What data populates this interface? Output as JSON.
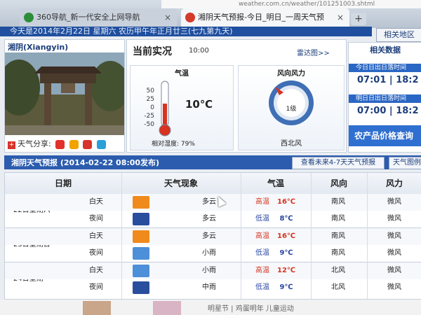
{
  "browser": {
    "tab1_title": "360导航_新一代安全上网导航",
    "tab2_title": "湘阴天气预报-今日_明日_一周天气预",
    "close_glyph": "×",
    "new_tab_glyph": "+",
    "url_fragment": "weather.com.cn/weather/101251003.shtml"
  },
  "header": {
    "date_line": "今天是2014年2月22日 星期六 农历甲午年正月廿三(七九第九天)",
    "region_button": "相关地区"
  },
  "city": {
    "name": "湘阴(Xiangyin)",
    "share_label": "天气分享:",
    "share_plus": "+",
    "social_colors": [
      "#e0312a",
      "#f2a300",
      "#d6332a",
      "#2a9fd8"
    ]
  },
  "current": {
    "title": "当前实况",
    "time": "10:00",
    "radar_link": "雷达图>>",
    "temp_label": "气温",
    "scale": [
      "50",
      "25",
      "0",
      "-25",
      "-50"
    ],
    "temp_value": "10℃",
    "humidity": "相对湿度: 79%",
    "wind_label": "风向风力",
    "wind_level": "1级",
    "wind_direction": "西北风"
  },
  "sidebar": {
    "title": "相关数据",
    "today_sun_label": "今日日出日落时间",
    "today_sunrise": "07:01",
    "today_sunset": "18:2",
    "tomorrow_sun_label": "明日日出日落时间",
    "tomorrow_sunrise": "07:00",
    "tomorrow_sunset": "18:2",
    "agri_link": "农产品价格查询"
  },
  "forecast": {
    "title": "湘阴天气预报 (2014-02-22 08:00发布)",
    "btn_week": "查看未来4-7天天气预报",
    "btn_map": "天气图例",
    "headers": [
      "日期",
      "天气现象",
      "气温",
      "风向",
      "风力"
    ],
    "days": [
      {
        "date": "22日星期六",
        "rows": [
          {
            "period": "白天",
            "icon": "cloudy-day-icon",
            "weather": "多云",
            "temp_label": "高温",
            "temp": "16℃",
            "wind_dir": "南风",
            "wind_force": "微风"
          },
          {
            "period": "夜间",
            "icon": "cloudy-night-icon",
            "weather": "多云",
            "temp_label": "低温",
            "temp": "8℃",
            "wind_dir": "南风",
            "wind_force": "微风"
          }
        ]
      },
      {
        "date": "23日星期日",
        "rows": [
          {
            "period": "白天",
            "icon": "cloudy-day-icon",
            "weather": "多云",
            "temp_label": "高温",
            "temp": "16℃",
            "wind_dir": "南风",
            "wind_force": "微风"
          },
          {
            "period": "夜间",
            "icon": "light-rain-icon",
            "weather": "小雨",
            "temp_label": "低温",
            "temp": "9℃",
            "wind_dir": "南风",
            "wind_force": "微风"
          }
        ]
      },
      {
        "date": "24日星期一",
        "rows": [
          {
            "period": "白天",
            "icon": "light-rain-icon",
            "weather": "小雨",
            "temp_label": "高温",
            "temp": "12℃",
            "wind_dir": "北风",
            "wind_force": "微风"
          },
          {
            "period": "夜间",
            "icon": "moderate-rain-icon",
            "weather": "中雨",
            "temp_label": "低温",
            "temp": "9℃",
            "wind_dir": "北风",
            "wind_force": "微风"
          }
        ]
      }
    ]
  },
  "footer": {
    "text": "明星节 | 鸡蛋明年 儿童运动"
  },
  "colors": {
    "accent": "#2b5cae",
    "high_temp": "#d7331f",
    "low_temp": "#2845a0"
  }
}
